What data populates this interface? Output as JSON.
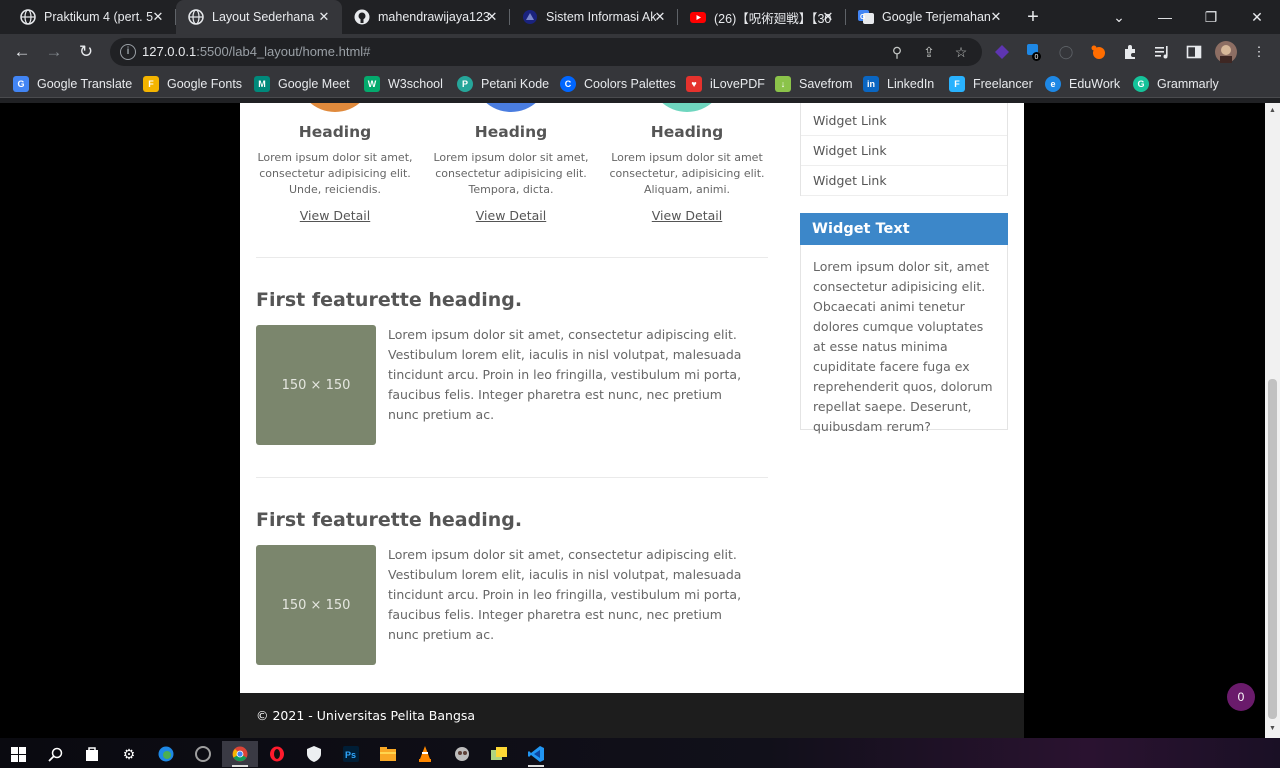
{
  "browser": {
    "tabs": [
      {
        "title": "Praktikum 4 (pert. 5",
        "active": false,
        "icon": "globe-icon"
      },
      {
        "title": "Layout Sederhana",
        "active": true,
        "icon": "globe-icon"
      },
      {
        "title": "mahendrawijaya123",
        "active": false,
        "icon": "github-icon"
      },
      {
        "title": "Sistem Informasi Ak",
        "active": false,
        "icon": "app-icon"
      },
      {
        "title": "(26)【呪術廻戦】【30",
        "active": false,
        "icon": "youtube-icon"
      },
      {
        "title": "Google Terjemahan",
        "active": false,
        "icon": "google-translate-icon"
      }
    ],
    "url": {
      "host": "127.0.0.1",
      "rest": ":5500/lab4_layout/home.html#"
    },
    "extension_badge": "0",
    "bookmarks": [
      {
        "label": "Google Translate",
        "color": "#4285f4"
      },
      {
        "label": "Google Fonts",
        "color": "#f4b400"
      },
      {
        "label": "Google Meet",
        "color": "#00897b"
      },
      {
        "label": "W3school",
        "color": "#04aa6d"
      },
      {
        "label": "Petani Kode",
        "color": "#26a69a"
      },
      {
        "label": "Coolors Palettes",
        "color": "#0066ff"
      },
      {
        "label": "iLovePDF",
        "color": "#e5322d"
      },
      {
        "label": "Savefrom",
        "color": "#8bc34a"
      },
      {
        "label": "LinkedIn",
        "color": "#0a66c2"
      },
      {
        "label": "Freelancer",
        "color": "#29b2fe"
      },
      {
        "label": "EduWork",
        "color": "#1e88e5"
      },
      {
        "label": "Grammarly",
        "color": "#15c39a"
      }
    ]
  },
  "page": {
    "columns": [
      {
        "heading": "Heading",
        "text": "Lorem ipsum dolor sit amet, consectetur adipisicing elit. Unde, reiciendis.",
        "link": "View Detail",
        "color": "#e08a3c"
      },
      {
        "heading": "Heading",
        "text": "Lorem ipsum dolor sit amet, consectetur adipisicing elit. Tempora, dicta.",
        "link": "View Detail",
        "color": "#4a7de0"
      },
      {
        "heading": "Heading",
        "text": "Lorem ipsum dolor sit amet consectetur, adipisicing elit. Aliquam, animi.",
        "link": "View Detail",
        "color": "#6fd6bf"
      }
    ],
    "featurettes": [
      {
        "heading": "First featurette heading.",
        "image_label": "150 × 150",
        "text": "Lorem ipsum dolor sit amet, consectetur adipiscing elit. Vestibulum lorem elit, iaculis in nisl volutpat, malesuada tincidunt arcu. Proin in leo fringilla, vestibulum mi porta, faucibus felis. Integer pharetra est nunc, nec pretium nunc pretium ac."
      },
      {
        "heading": "First featurette heading.",
        "image_label": "150 × 150",
        "text": "Lorem ipsum dolor sit amet, consectetur adipiscing elit. Vestibulum lorem elit, iaculis in nisl volutpat, malesuada tincidunt arcu. Proin in leo fringilla, vestibulum mi porta, faucibus felis. Integer pharetra est nunc, nec pretium nunc pretium ac."
      }
    ],
    "sidebar": {
      "widget_links": [
        "Widget Link",
        "Widget Link",
        "Widget Link"
      ],
      "widget_text_title": "Widget Text",
      "widget_text_body": "Lorem ipsum dolor sit, amet consectetur adipisicing elit. Obcaecati animi tenetur dolores cumque voluptates at esse natus minima cupiditate facere fuga ex reprehenderit quos, dolorum repellat saepe. Deserunt, quibusdam rerum?"
    },
    "footer": "© 2021 - Universitas Pelita Bangsa",
    "notification_badge": "0"
  }
}
